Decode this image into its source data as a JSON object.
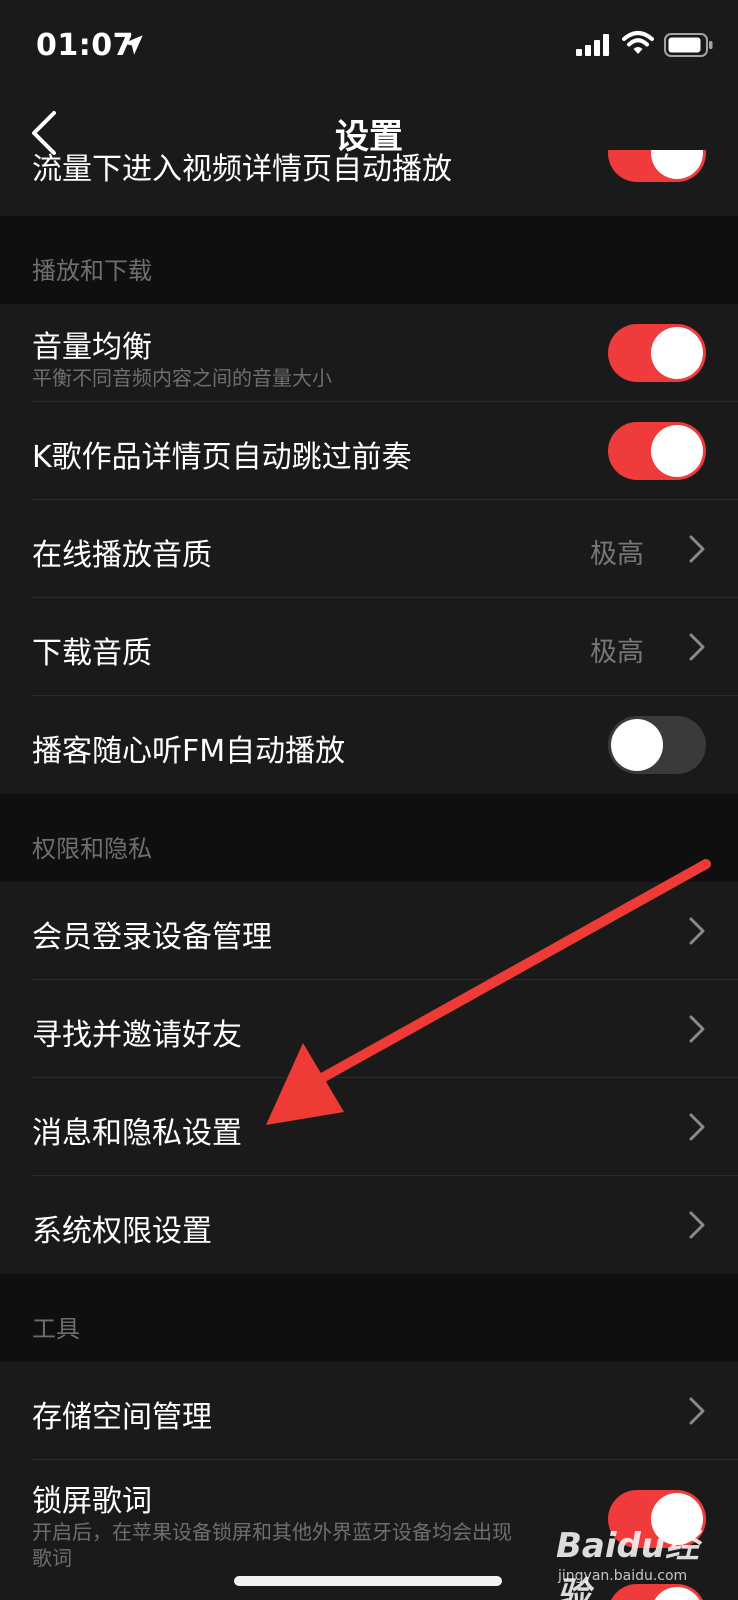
{
  "status_bar": {
    "time": "01:07"
  },
  "nav": {
    "title": "设置"
  },
  "clipped_row": {
    "label": "流量下进入视频详情页自动播放",
    "toggle_on": true
  },
  "sections": [
    {
      "title": "播放和下载",
      "rows": [
        {
          "label": "音量均衡",
          "sublabel": "平衡不同音频内容之间的音量大小",
          "control": "toggle",
          "on": true
        },
        {
          "label": "K歌作品详情页自动跳过前奏",
          "control": "toggle",
          "on": true
        },
        {
          "label": "在线播放音质",
          "value": "极高",
          "control": "chevron"
        },
        {
          "label": "下载音质",
          "value": "极高",
          "control": "chevron"
        },
        {
          "label": "播客随心听FM自动播放",
          "control": "toggle",
          "on": false
        }
      ]
    },
    {
      "title": "权限和隐私",
      "rows": [
        {
          "label": "会员登录设备管理",
          "control": "chevron"
        },
        {
          "label": "寻找并邀请好友",
          "control": "chevron"
        },
        {
          "label": "消息和隐私设置",
          "control": "chevron"
        },
        {
          "label": "系统权限设置",
          "control": "chevron"
        }
      ]
    },
    {
      "title": "工具",
      "rows": [
        {
          "label": "存储空间管理",
          "control": "chevron"
        },
        {
          "label": "锁屏歌词",
          "sublabel_line1": "开启后，在苹果设备锁屏和其他外界蓝牙设备均会出现",
          "sublabel_line2": "歌词",
          "control": "toggle",
          "on": true
        }
      ]
    }
  ],
  "watermark": {
    "logo": "Baidu经验",
    "site": "jingyan.baidu.com"
  },
  "colors": {
    "accent": "#ef3b3b",
    "row_bg": "#1a1a1a",
    "page_bg": "#0f0f0f",
    "arrow": "#ee3b35"
  }
}
